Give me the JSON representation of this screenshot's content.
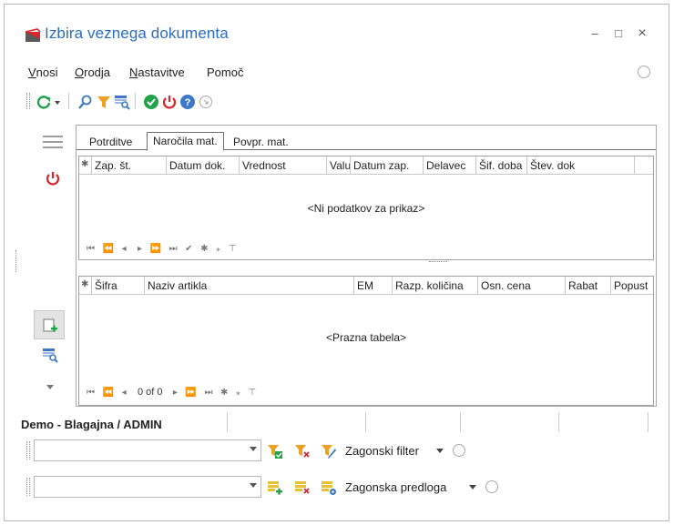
{
  "window": {
    "title": "Izbira veznega dokumenta",
    "minimize_glyph": "–",
    "maximize_glyph": "□",
    "close_glyph": "×"
  },
  "menu": {
    "items": [
      {
        "first": "V",
        "rest": "nosi"
      },
      {
        "first": "O",
        "rest": "rodja"
      },
      {
        "first": "N",
        "rest": "astavitve"
      },
      {
        "first": "",
        "rest": "Pomoč"
      }
    ]
  },
  "toolbar": {
    "icons": [
      "refresh-icon",
      "search-icon",
      "filter-icon",
      "table-search-icon",
      "confirm-icon",
      "power-icon",
      "help-icon",
      "circle-icon"
    ]
  },
  "tabs": [
    {
      "label": "Potrditve",
      "active": false
    },
    {
      "label": "Naročila mat.",
      "active": true
    },
    {
      "label": "Povpr. mat.",
      "active": false
    }
  ],
  "upper_grid": {
    "columns": [
      "Zap. št.",
      "Datum dok.",
      "Vrednost",
      "Valu",
      "Datum zap.",
      "Delavec",
      "Šif. doba",
      "Štev. dok"
    ],
    "empty_text": "<Ni podatkov za prikaz>",
    "nav_text": "⏮ ⏪ ◀ ▶ ⏩ ⏭ ✔ ✱ ⁎ ⊤"
  },
  "lower_grid": {
    "columns": [
      "Šifra",
      "Naziv artikla",
      "EM",
      "Razp. količina",
      "Osn. cena",
      "Rabat",
      "Popust"
    ],
    "empty_text": "<Prazna tabela>",
    "nav_counter": "0 of 0"
  },
  "status": {
    "text": "Demo - Blagajna / ADMIN"
  },
  "filter_row": {
    "label": "Zagonski filter",
    "value": ""
  },
  "template_row": {
    "label": "Zagonska predloga",
    "value": ""
  },
  "colors": {
    "title": "#2a6cc4",
    "green": "#22a34a",
    "red": "#d9262c",
    "blue": "#3c78c8",
    "orange": "#f0a020"
  }
}
